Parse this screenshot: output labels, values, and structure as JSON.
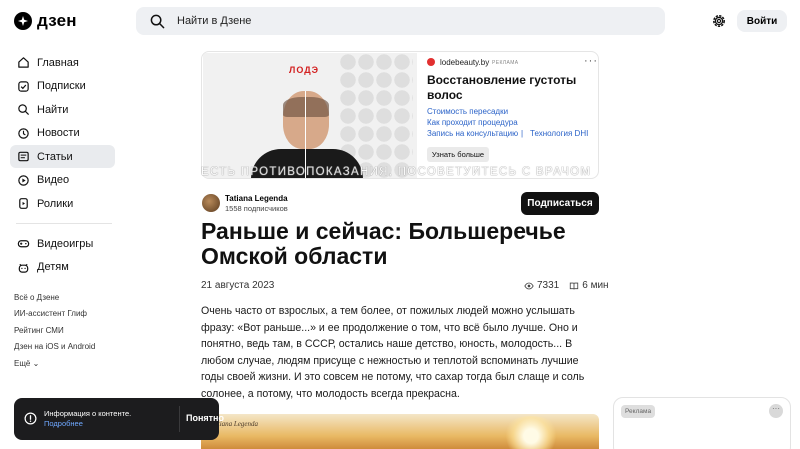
{
  "header": {
    "logo_text": "дзен",
    "search_placeholder": "Найти в Дзене",
    "login_label": "Войти"
  },
  "sidebar": {
    "items": [
      {
        "label": "Главная",
        "icon": "home-icon"
      },
      {
        "label": "Подписки",
        "icon": "subscriptions-icon"
      },
      {
        "label": "Найти",
        "icon": "search-icon"
      },
      {
        "label": "Новости",
        "icon": "news-icon"
      },
      {
        "label": "Статьи",
        "icon": "articles-icon",
        "active": true
      },
      {
        "label": "Видео",
        "icon": "video-icon"
      },
      {
        "label": "Ролики",
        "icon": "shorts-icon"
      }
    ],
    "items2": [
      {
        "label": "Видеоигры",
        "icon": "gamepad-icon"
      },
      {
        "label": "Детям",
        "icon": "kids-icon"
      }
    ],
    "footer_links": [
      "Всё о Дзене",
      "ИИ-ассистент Глиф",
      "Рейтинг СМИ",
      "Дзен на iOS и Android",
      "Ещё"
    ]
  },
  "ad": {
    "brand": "ЛОДЭ",
    "domain": "lodebeauty.by",
    "tag": "РЕКЛАМА",
    "title": "Восстановление густоты волос",
    "links": [
      "Стоимость пересадки",
      "Как проходит процедура",
      "Запись на консультацию",
      "Технология DHI"
    ],
    "separator": "|",
    "button": "Узнать больше",
    "disclaimer": "ЕСТЬ ПРОТИВОПОКАЗАНИЯ, ПОСОВЕТУЙТЕСЬ С ВРАЧОМ"
  },
  "author": {
    "name": "Tatiana Legenda",
    "subscribers": "1558 подписчиков",
    "subscribe_label": "Подписаться"
  },
  "article": {
    "title": "Раньше и сейчас: Большеречье Омской области",
    "date": "21 августа 2023",
    "views": "7331",
    "read_time": "6 мин",
    "body": "Очень часто от взрослых, а тем более, от пожилых людей можно услышать фразу: «Вот раньше...» и ее продолжение о том, что всё было лучше. Оно и понятно, ведь там, в СССР, остались наше детство, юность, молодость... В любом случае, людям присуще с нежностью и теплотой вспоминать лучшие годы своей жизни. И это совсем не потому, что сахар тогда был слаще и соль солонее, а потому, что молодость всегда прекрасна.",
    "photo_signature": "Tatiana Legenda"
  },
  "toast": {
    "text": "Информация о контенте.",
    "link": "Подробнее",
    "button": "Понятно"
  },
  "right_card": {
    "badge": "Реклама",
    "more": "···"
  }
}
